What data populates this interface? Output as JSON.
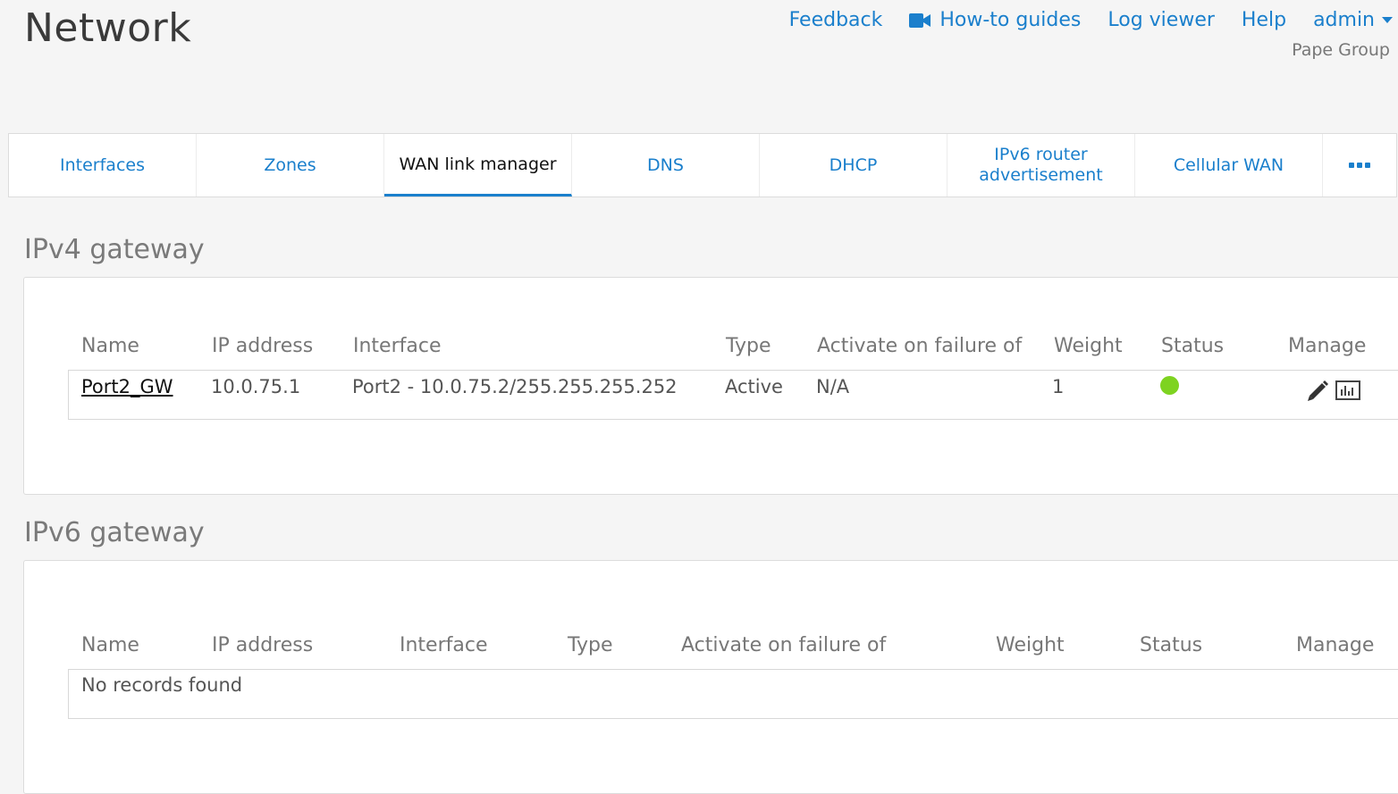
{
  "header": {
    "title": "Network",
    "nav": {
      "feedback": "Feedback",
      "howto": "How-to guides",
      "logviewer": "Log viewer",
      "help": "Help",
      "user": "admin"
    },
    "org": "Pape Group",
    "accent_color": "#1a7fcc"
  },
  "tabs": [
    {
      "label": "Interfaces"
    },
    {
      "label": "Zones"
    },
    {
      "label": "WAN link manager",
      "active": true
    },
    {
      "label": "DNS"
    },
    {
      "label": "DHCP"
    },
    {
      "label": "IPv6 router advertisement"
    },
    {
      "label": "Cellular WAN"
    },
    {
      "label": "more",
      "icon": "more-icon"
    }
  ],
  "ipv4": {
    "title": "IPv4 gateway",
    "columns": [
      "Name",
      "IP address",
      "Interface",
      "Type",
      "Activate on failure of",
      "Weight",
      "Status",
      "Manage"
    ],
    "rows": [
      {
        "name": "Port2_GW",
        "ip": "10.0.75.1",
        "interface": "Port2 - 10.0.75.2/255.255.255.252",
        "type": "Active",
        "failover": "N/A",
        "weight": "1",
        "status_color": "#7ed321"
      }
    ]
  },
  "ipv6": {
    "title": "IPv6 gateway",
    "columns": [
      "Name",
      "IP address",
      "Interface",
      "Type",
      "Activate on failure of",
      "Weight",
      "Status",
      "Manage"
    ],
    "empty_text": "No records found"
  }
}
